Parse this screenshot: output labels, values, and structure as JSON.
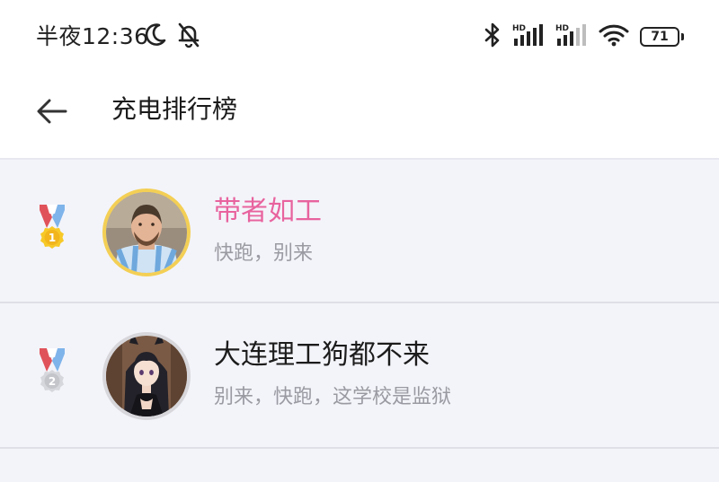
{
  "status_bar": {
    "time": "半夜12:36",
    "icons": [
      "moon-icon",
      "bell-off-icon",
      "bluetooth-icon",
      "hd-signal-1-icon",
      "hd-signal-2-icon",
      "wifi-icon",
      "battery-icon"
    ],
    "battery_level": "71"
  },
  "app_bar": {
    "back_icon": "back-arrow-icon",
    "title": "充电排行榜"
  },
  "ranking": [
    {
      "rank": "1",
      "medal": "gold-medal-icon",
      "avatar": "avatar-football-player",
      "name": "带者如工",
      "subtitle": "快跑，别来",
      "name_color": "#e8639e"
    },
    {
      "rank": "2",
      "medal": "silver-medal-icon",
      "avatar": "avatar-anime-girl",
      "name": "大连理工狗都不来",
      "subtitle": "别来，快跑，这学校是监狱",
      "name_color": "#1c1c1c"
    }
  ],
  "colors": {
    "accent_pink": "#e8639e",
    "gold": "#f3cf55",
    "silver": "#d7d7db",
    "list_background": "#f3f4fa"
  }
}
